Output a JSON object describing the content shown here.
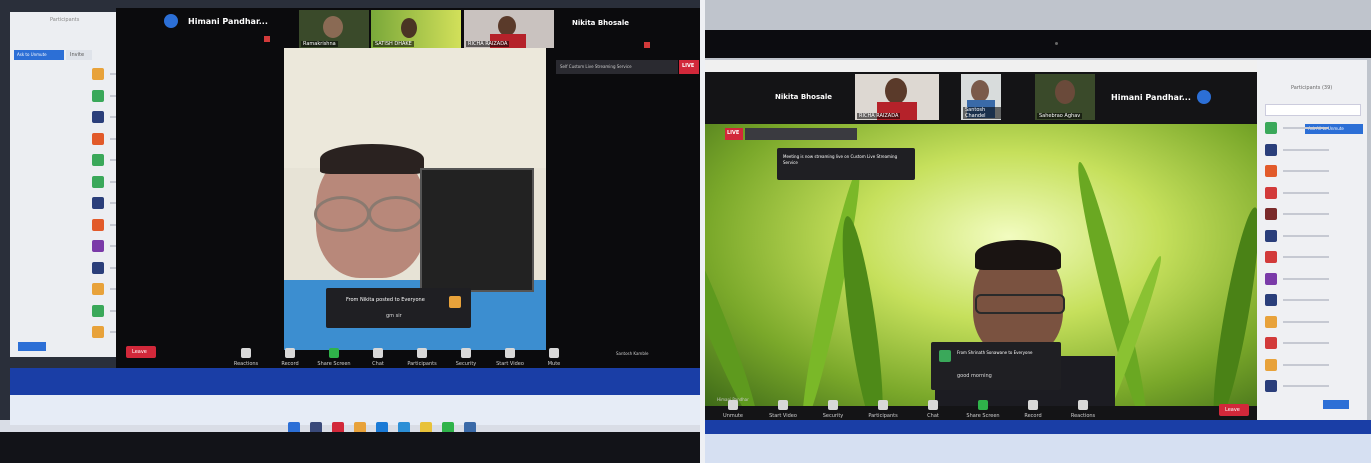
{
  "left_photo": {
    "speaker_name": "Himani Pandhar...",
    "header_tiles": [
      {
        "name": "Ramakrishna"
      },
      {
        "name": "SATISH DHAKE"
      },
      {
        "name": "RICHA RAIZADA"
      },
      {
        "name": "Nikita Bhosale"
      }
    ],
    "live_label": "LIVE",
    "live_banner": "Self Custom Live Streaming Service",
    "chat_from": "From Nikita posted to Everyone",
    "chat_message": "gm sir",
    "leave_label": "Leave",
    "toolbar": [
      {
        "label": "Mute",
        "icon": "microphone-icon"
      },
      {
        "label": "Start Video",
        "icon": "video-camera-icon"
      },
      {
        "label": "Security",
        "icon": "shield-icon"
      },
      {
        "label": "Participants",
        "icon": "participants-icon"
      },
      {
        "label": "Chat",
        "icon": "chat-icon"
      },
      {
        "label": "Share Screen",
        "icon": "share-screen-icon"
      },
      {
        "label": "Record",
        "icon": "record-icon"
      },
      {
        "label": "Reactions",
        "icon": "smile-icon"
      }
    ],
    "presenter_label": "Santosh Kamble",
    "participants_title": "Participants",
    "participant_tab": "Invite",
    "ask_button": "Ask to Unmute",
    "participant_colors": [
      "#e8a23a",
      "#3aa85a",
      "#2a3e7a",
      "#e25a2a",
      "#3aa85a",
      "#3aa85a",
      "#2a3e7a",
      "#e25a2a",
      "#7a3aa8",
      "#2a3e7a",
      "#e8a23a",
      "#3aa85a",
      "#e8a23a"
    ]
  },
  "right_photo": {
    "header_tiles": [
      {
        "name": "Nikita Bhosale"
      },
      {
        "name": "RICHA RAIZADA"
      },
      {
        "name": "Santosh Chandel"
      },
      {
        "name": "Sahebrao Aghav"
      },
      {
        "name": "Himani Pandhar..."
      }
    ],
    "live_label": "LIVE",
    "live_notice": "Meeting is now streaming live on Custom Live Streaming Service",
    "chat_from": "From Shrinath Sonawane to Everyone",
    "chat_message": "good morning",
    "presenter_label": "Himani Pandhar",
    "leave_label": "Leave",
    "toolbar": [
      {
        "label": "Unmute",
        "icon": "microphone-icon"
      },
      {
        "label": "Start Video",
        "icon": "video-camera-icon"
      },
      {
        "label": "Security",
        "icon": "shield-icon"
      },
      {
        "label": "Participants",
        "icon": "participants-icon"
      },
      {
        "label": "Chat",
        "icon": "chat-icon"
      },
      {
        "label": "Share Screen",
        "icon": "share-screen-icon"
      },
      {
        "label": "Record",
        "icon": "record-icon"
      },
      {
        "label": "Reactions",
        "icon": "smile-icon"
      }
    ],
    "participants_title": "Participants (39)",
    "ask_button": "Ask All to Unmute",
    "participant_colors": [
      "#3aa85a",
      "#2a3e7a",
      "#e25a2a",
      "#d23a3a",
      "#7a2a2a",
      "#2a3e7a",
      "#d23a3a",
      "#7a3aa8",
      "#2a3e7a",
      "#e8a23a",
      "#d23a3a",
      "#e8a23a",
      "#2a3e7a"
    ]
  }
}
